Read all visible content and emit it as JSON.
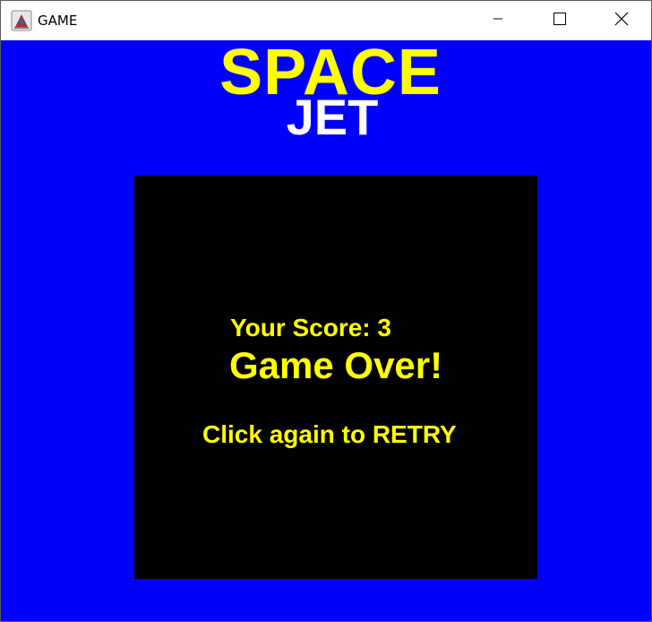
{
  "window": {
    "title": "GAME",
    "icon": "java-app-icon",
    "controls": {
      "minimize_icon": "minimize-icon",
      "maximize_icon": "maximize-icon",
      "close_icon": "close-icon"
    }
  },
  "game": {
    "title_line1": "SPACE",
    "title_line2": "JET",
    "score_text": "Your Score: 3",
    "score_value": 3,
    "game_over_text": "Game Over!",
    "retry_text": "Click again to RETRY"
  },
  "colors": {
    "background": "#0000ff",
    "board": "#000000",
    "accent_text": "#ffff00",
    "secondary_title": "#ffffff"
  }
}
